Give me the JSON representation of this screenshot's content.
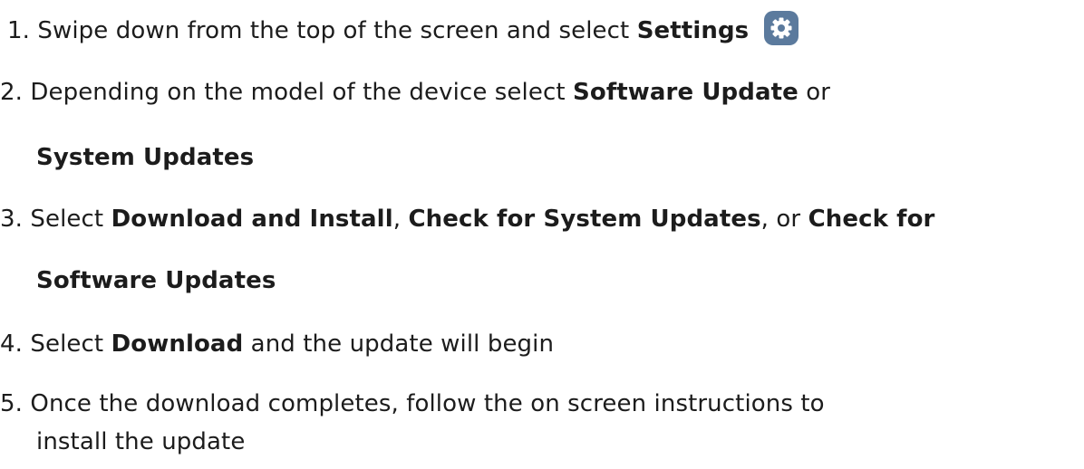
{
  "steps": [
    {
      "number": "1.",
      "pre": "Swipe down from the top of the screen and select",
      "bold1": "Settings"
    },
    {
      "number": "2.",
      "pre": "Depending on the model of the device select",
      "bold1": "Software Update",
      "mid": "or",
      "bold2": "System Updates"
    },
    {
      "number": "3.",
      "pre": "Select",
      "bold1": "Download and Install",
      "sep1": ",",
      "bold2": "Check for System Updates",
      "sep2": ", or",
      "bold3a": "Check for",
      "bold3b": "Software Updates"
    },
    {
      "number": "4.",
      "pre": "Select",
      "bold1": "Download",
      "post": "and the update will begin"
    },
    {
      "number": "5.",
      "line1": "Once the download completes, follow the on screen instructions to",
      "line2": "install the update"
    }
  ],
  "icons": {
    "settings": "gear-icon",
    "settings_bg": "#5b7a9d"
  }
}
